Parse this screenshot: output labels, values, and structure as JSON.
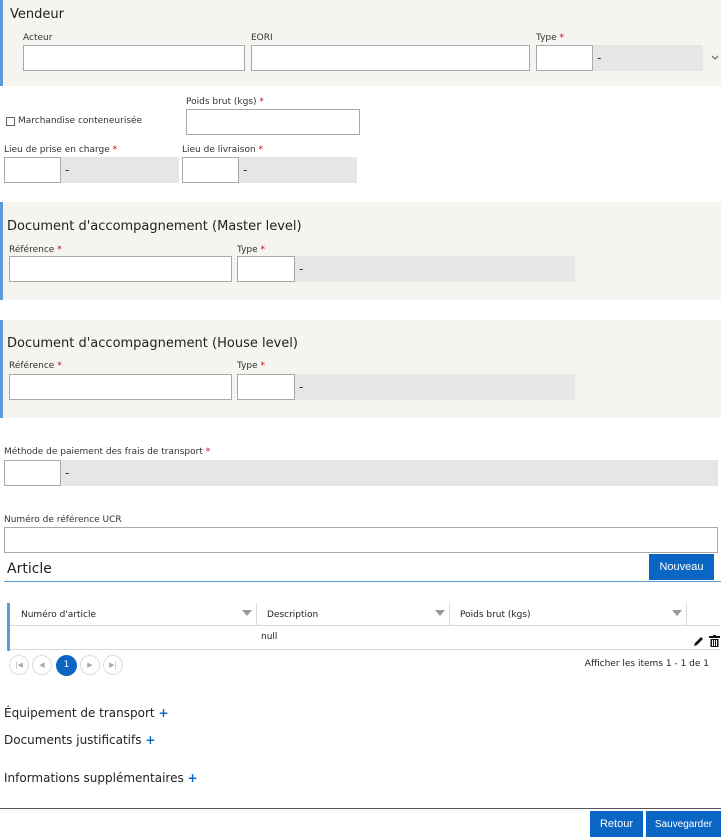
{
  "vendeur": {
    "title": "Vendeur",
    "acteur_label": "Acteur",
    "eori_label": "EORI",
    "type_label": "Type",
    "type_value": "-"
  },
  "marchandise": {
    "checkbox_label": "Marchandise conteneurisée",
    "poids_label": "Poids brut (kgs)",
    "prise_label": "Lieu de prise en charge",
    "prise_value": "-",
    "livraison_label": "Lieu de livraison",
    "livraison_value": "-"
  },
  "doc_master": {
    "title": "Document d'accompagnement (Master level)",
    "reference_label": "Référence",
    "type_label": "Type",
    "type_value": "-"
  },
  "doc_house": {
    "title": "Document d'accompagnement (House level)",
    "reference_label": "Référence",
    "type_label": "Type",
    "type_value": "-"
  },
  "paiement": {
    "label": "Méthode de paiement des frais de transport",
    "value": "-"
  },
  "ucr": {
    "label": "Numéro de référence UCR"
  },
  "article": {
    "title": "Article",
    "new_button": "Nouveau",
    "columns": [
      "Numéro d'article",
      "Description",
      "Poids brut (kgs)"
    ],
    "rows": [
      {
        "numero": "",
        "description": "null",
        "poids": ""
      }
    ],
    "pager": {
      "current_page": "1",
      "info": "Afficher les items 1 - 1 de 1"
    }
  },
  "sections": {
    "equipement": "Équipement de transport",
    "documents": "Documents justificatifs",
    "informations": "Informations supplémentaires",
    "plus": "+"
  },
  "footer": {
    "retour": "Retour",
    "sauvegarder": "Sauvegarder"
  },
  "required_mark": "*",
  "colors": {
    "accent": "#0a66c2",
    "panel_border": "#5b9bd5",
    "panel_bg": "#f5f4f0",
    "required": "#cc0000"
  }
}
